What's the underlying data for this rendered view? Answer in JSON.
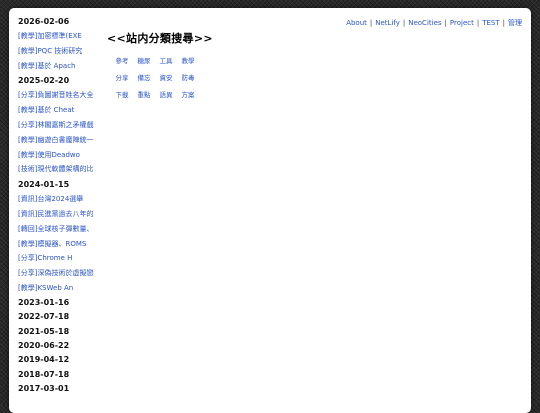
{
  "nav": {
    "items": [
      "About",
      "NetLify",
      "NeoCities",
      "Project",
      "TEST",
      "管理"
    ]
  },
  "main": {
    "title": "<<站内分類搜尋>>",
    "categories": [
      "參考",
      "糖尿",
      "工具",
      "教學",
      "分享",
      "備忘",
      "資安",
      "防毒",
      "下載",
      "重點",
      "語異",
      "方案"
    ]
  },
  "sidebar": {
    "groups": [
      {
        "date": "2026-02-06",
        "posts": [
          "[教學]加密標準(EXE",
          "[教學]PQC 技術研究",
          "[教學]基於 Apach"
        ]
      },
      {
        "date": "2025-02-20",
        "posts": [
          "[分享]負圖謝音姓名大全",
          "[教學]基於 Cheat",
          "[分享]林閣嘉斯之矛權戲",
          "[教學]幽遊白書魔陣統一",
          "[教學]使用Deadwo",
          "[技術]現代軟體架構的比"
        ]
      },
      {
        "date": "2024-01-15",
        "posts": [
          "[資訊]台灣2024選舉",
          "[資訊]民進黨過去八年的",
          "[轉回]全球核子彈數量、",
          "[教學]模擬器、ROMS",
          "[分享]Chrome H",
          "[分享]深偽技術於虛擬戀",
          "[教學]KSWeb An"
        ]
      },
      {
        "date": "2023-01-16",
        "posts": []
      },
      {
        "date": "2022-07-18",
        "posts": []
      },
      {
        "date": "2021-05-18",
        "posts": []
      },
      {
        "date": "2020-06-22",
        "posts": []
      },
      {
        "date": "2019-04-12",
        "posts": []
      },
      {
        "date": "2018-07-18",
        "posts": []
      },
      {
        "date": "2017-03-01",
        "posts": []
      }
    ]
  }
}
